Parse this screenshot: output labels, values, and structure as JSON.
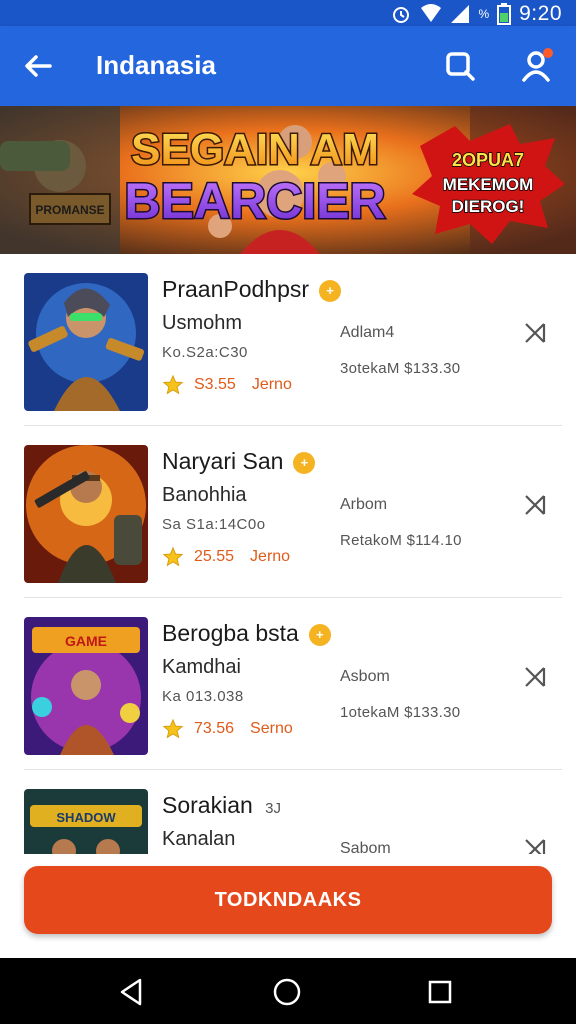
{
  "status_bar": {
    "time": "9:20",
    "percent_glyph": "%"
  },
  "app_bar": {
    "title": "Indanasia"
  },
  "banner": {
    "title_line1": "SEGAIN AM",
    "title_line2": "BEARCIER",
    "burst_line1": "2OPUA7",
    "burst_line2": "MEKEMOM",
    "burst_line3": "DIEROG!",
    "sign_text": "PROMANSE"
  },
  "games": [
    {
      "name": "PraanPodhpsr",
      "developer": "Usmohm",
      "code": "Ko.S2a:C30",
      "rating": "S3.55",
      "tag": "Jerno",
      "meta_label": "Adlam4",
      "meta_price": "3otekaM $133.30",
      "badge": "+"
    },
    {
      "name": "Naryari San",
      "developer": "Banohhia",
      "code": "Sa S1a:14C0o",
      "rating": "25.55",
      "tag": "Jerno",
      "meta_label": "Arbom",
      "meta_price": "RetakoM $114.10",
      "badge": "+"
    },
    {
      "name": "Berogba bsta",
      "developer": "Kamdhai",
      "code": "Ka 013.038",
      "rating": "73.56",
      "tag": "Serno",
      "meta_label": "Asbom",
      "meta_price": "1otekaM $133.30",
      "badge": "+"
    },
    {
      "name": "Sorakian",
      "name_extra": "3J",
      "developer": "Kanalan",
      "code": "",
      "rating": "",
      "tag": "",
      "meta_label": "Sabom",
      "meta_price": "",
      "badge": ""
    }
  ],
  "cta": {
    "label": "TODKNDAAKS"
  },
  "colors": {
    "primary": "#2466de",
    "accent": "#e5491b",
    "coin": "#f5b321",
    "star": "#f7c21a"
  }
}
